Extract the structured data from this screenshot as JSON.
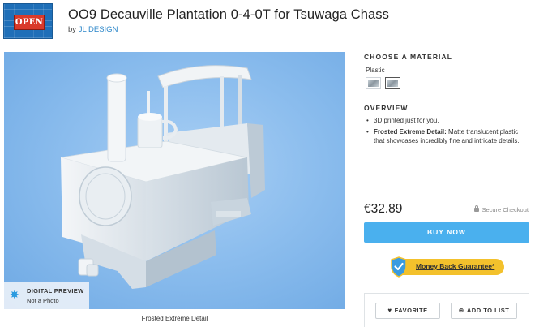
{
  "header": {
    "logo_sign_text": "OPEN",
    "title": "OO9 Decauville Plantation 0-4-0T for Tsuwaga Chass",
    "by_prefix": "by",
    "designer": "JL DESIGN"
  },
  "image": {
    "preview_title": "DIGITAL PREVIEW",
    "preview_subtitle": "Not a Photo",
    "caption": "Frosted Extreme Detail",
    "background_color": "#8dbeee",
    "preview_icon": "star-burst-icon"
  },
  "material": {
    "heading": "CHOOSE A MATERIAL",
    "group_label": "Plastic",
    "swatch_count": 2,
    "selected_index": 1
  },
  "overview": {
    "heading": "OVERVIEW",
    "bullet1": "3D printed just for you.",
    "bullet2_bold": "Frosted Extreme Detail:",
    "bullet2_text": "Matte translucent plastic that showcases incredibly fine and intricate details."
  },
  "purchase": {
    "price": "€32.89",
    "secure_label": "Secure Checkout",
    "buy_label": "BUY NOW",
    "buy_color": "#4ab0ee",
    "guarantee_label": "Money Back Guarantee*",
    "guarantee_color": "#f3c12c"
  },
  "actions": {
    "favorite_label": "FAVORITE",
    "add_to_list_label": "ADD TO LIST"
  }
}
